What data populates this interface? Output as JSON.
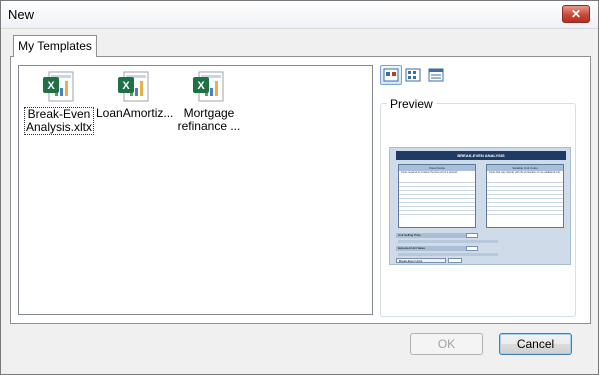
{
  "window": {
    "title": "New",
    "close_label": "✕"
  },
  "tabs": [
    {
      "label": "My Templates",
      "selected": true
    }
  ],
  "templates": [
    {
      "label": "Break-Even\nAnalysis.xltx",
      "icon": "excel-template-icon",
      "selected": true
    },
    {
      "label": "LoanAmortiz...",
      "icon": "excel-template-icon",
      "selected": false
    },
    {
      "label": "Mortgage\nrefinance ...",
      "icon": "excel-template-icon",
      "selected": false
    }
  ],
  "view_modes": [
    {
      "name": "large-icons-view-button",
      "icon": "large-icons-icon",
      "active": true
    },
    {
      "name": "list-view-button",
      "icon": "list-icon",
      "active": false
    },
    {
      "name": "details-view-button",
      "icon": "details-icon",
      "active": false
    }
  ],
  "preview": {
    "label": "Preview",
    "sheet_title": "BREAK-EVEN ANALYSIS",
    "fixed_costs_header": "Fixed Costs",
    "variable_costs_header": "Variable Unit Costs",
    "fixed_costs_desc": "Costs required to produce the first unit of a product",
    "variable_costs_desc": "Costs that vary directly with the production of one additional unit",
    "definitions_label": "Definitions",
    "cost_label": "Cost",
    "unit_selling_price_label": "Unit Selling Price",
    "expected_unit_sales_label": "Expected Unit Sales",
    "break_even_units_label": "Break-Even Units"
  },
  "buttons": {
    "ok": "OK",
    "cancel": "Cancel"
  },
  "colors": {
    "sheet_title_bg": "#1f3a63",
    "sheet_bg": "#cfdbe8",
    "excel_green": "#1e7145",
    "close_red": "#c84a36"
  }
}
